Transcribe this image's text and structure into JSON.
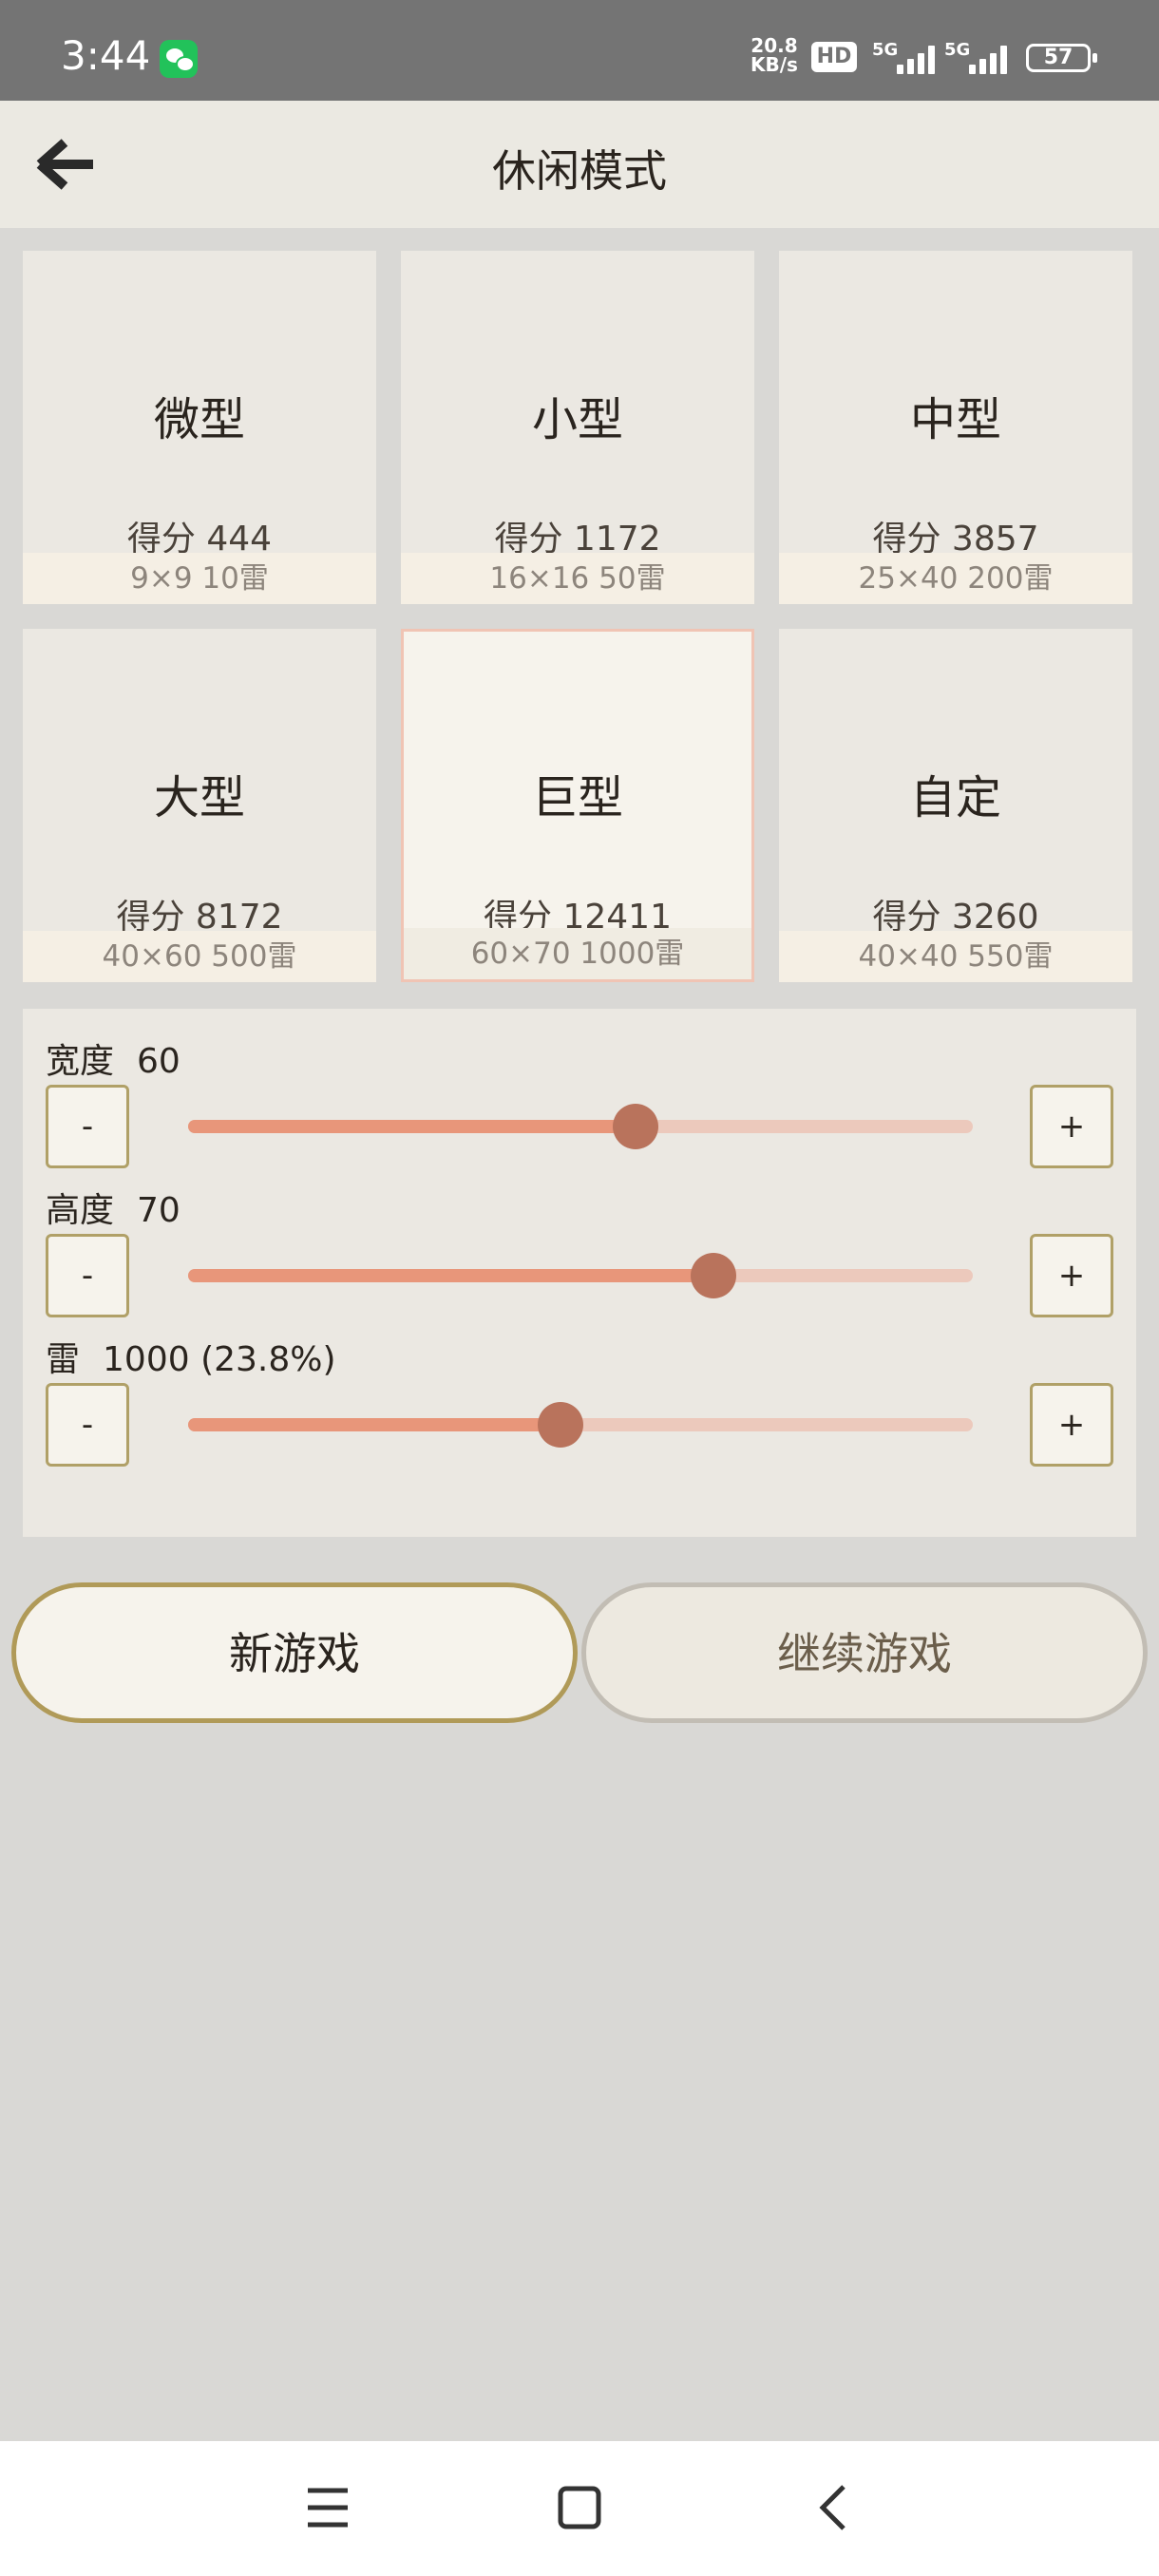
{
  "status_bar": {
    "time": "3:44",
    "app_icon": "wechat-icon",
    "speed_value": "20.8",
    "speed_unit": "KB/s",
    "hd_label": "HD",
    "network_1": "5G",
    "network_2": "5G",
    "battery": "57"
  },
  "header": {
    "title": "休闲模式",
    "back_icon": "back-arrow-icon"
  },
  "modes": [
    {
      "name": "微型",
      "score": "得分 444",
      "size": "9×9  10雷",
      "selected": false
    },
    {
      "name": "小型",
      "score": "得分 1172",
      "size": "16×16  50雷",
      "selected": false
    },
    {
      "name": "中型",
      "score": "得分 3857",
      "size": "25×40  200雷",
      "selected": false
    },
    {
      "name": "大型",
      "score": "得分 8172",
      "size": "40×60  500雷",
      "selected": false
    },
    {
      "name": "巨型",
      "score": "得分 12411",
      "size": "60×70  1000雷",
      "selected": true
    },
    {
      "name": "自定",
      "score": "得分 3260",
      "size": "40×40  550雷",
      "selected": false
    }
  ],
  "settings": {
    "width": {
      "label": "宽度",
      "value": "60",
      "level": 0.57
    },
    "height": {
      "label": "高度",
      "value": "70",
      "level": 0.67
    },
    "mines": {
      "label": "雷",
      "value": "1000 (23.8%)",
      "level": 0.475
    },
    "minus_label": "-",
    "plus_label": "+"
  },
  "buttons": {
    "new_game": "新游戏",
    "continue_game": "继续游戏"
  },
  "colors": {
    "accent": "#e8967a",
    "thumb": "#b9735c",
    "selected_border": "#f0c4b4",
    "primary_button_border": "#b09a58"
  },
  "nav": {
    "menu_icon": "menu-icon",
    "home_icon": "home-square-icon",
    "back_icon": "back-chevron-icon"
  }
}
